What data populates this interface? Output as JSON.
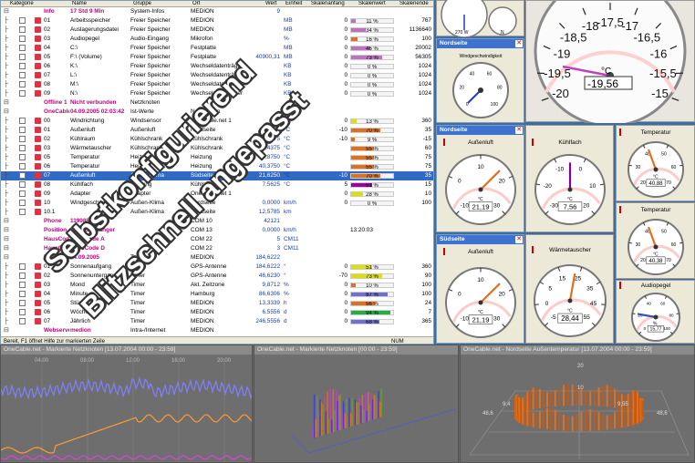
{
  "table": {
    "headers": {
      "category": "Kategorie",
      "name": "Name",
      "group": "Gruppe",
      "place": "Ort",
      "value": "Wert",
      "unit": "Einheit",
      "scale_start": "Skalenanfang",
      "scale_value": "Skalenwert",
      "scale_end": "Skalenende"
    },
    "rows": [
      {
        "kind": "group",
        "num": "Info",
        "name": "17 Std 9 Min",
        "group": "System-Infos",
        "place": "MEDION",
        "value": "9",
        "unit": "",
        "start": "",
        "bar_pct": null,
        "bar_color": "",
        "bar_text": "",
        "end": ""
      },
      {
        "kind": "item",
        "num": "01",
        "name": "Arbeitsspeicher",
        "group": "Freier Speicher",
        "place": "MEDION",
        "value": "",
        "unit": "MB",
        "start": "0",
        "bar_pct": 11,
        "bar_color": "#c070c0",
        "bar_text": "11 %",
        "end": "767"
      },
      {
        "kind": "item",
        "num": "02",
        "name": "Auslagerungsdatei",
        "group": "Freier Speicher",
        "place": "MEDION",
        "value": "",
        "unit": "MB",
        "start": "0",
        "bar_pct": 34,
        "bar_color": "#c070c0",
        "bar_text": "34 %",
        "end": "1136640"
      },
      {
        "kind": "item",
        "num": "03",
        "name": "Audiopegel",
        "group": "Audio-Eingang",
        "place": "Mikrofon",
        "value": "",
        "unit": "%",
        "start": "0",
        "bar_pct": 16,
        "bar_color": "#e07020",
        "bar_text": "16 %",
        "end": "100"
      },
      {
        "kind": "item",
        "num": "04",
        "name": "C:\\",
        "group": "Freier Speicher",
        "place": "Festplatte",
        "value": "",
        "unit": "MB",
        "start": "0",
        "bar_pct": 46,
        "bar_color": "#c070c0",
        "bar_text": "46 %",
        "end": "20002"
      },
      {
        "kind": "item",
        "num": "05",
        "name": "F:\\ (Volume)",
        "group": "Freier Speicher",
        "place": "Festplatte",
        "value": "40900,31",
        "unit": "MB",
        "start": "0",
        "bar_pct": 73,
        "bar_color": "#c070c0",
        "bar_text": "73 %",
        "end": "56305"
      },
      {
        "kind": "item",
        "num": "06",
        "name": "K:\\",
        "group": "Freier Speicher",
        "place": "Wechseldatenträger",
        "value": "",
        "unit": "KB",
        "start": "0",
        "bar_pct": 0,
        "bar_color": "#c070c0",
        "bar_text": "0 %",
        "end": "1024"
      },
      {
        "kind": "item",
        "num": "07",
        "name": "L:\\",
        "group": "Freier Speicher",
        "place": "Wechseldatenträger",
        "value": "",
        "unit": "KB",
        "start": "0",
        "bar_pct": 0,
        "bar_color": "#c070c0",
        "bar_text": "0 %",
        "end": "1024"
      },
      {
        "kind": "item",
        "num": "08",
        "name": "M:\\",
        "group": "Freier Speicher",
        "place": "Wechseldatenträger",
        "value": "",
        "unit": "KB",
        "start": "0",
        "bar_pct": 0,
        "bar_color": "#c070c0",
        "bar_text": "0 %",
        "end": "1024"
      },
      {
        "kind": "item",
        "num": "09",
        "name": "N:\\",
        "group": "Freier Speicher",
        "place": "Wechseldatenträger",
        "value": "",
        "unit": "KB",
        "start": "0",
        "bar_pct": 0,
        "bar_color": "#c070c0",
        "bar_text": "0 %",
        "end": "1024"
      },
      {
        "kind": "group",
        "num": "Offline 1",
        "name": "Nicht verbunden",
        "group": "Netzknoten",
        "place": "",
        "value": "",
        "unit": "",
        "start": "",
        "bar_pct": null,
        "bar_color": "",
        "bar_text": "",
        "end": ""
      },
      {
        "kind": "group",
        "num": "OneCable 1",
        "name": "04.09.2005 02:03:42",
        "group": "Ist-Werte",
        "place": "Netzknoten",
        "value": "",
        "unit": "",
        "start": "",
        "bar_pct": null,
        "bar_color": "",
        "bar_text": "",
        "end": ""
      },
      {
        "kind": "item",
        "num": "00",
        "name": "Windrichtung",
        "group": "Windsensor",
        "place": "OneCable.net 1",
        "value": "",
        "unit": "°",
        "start": "0",
        "bar_pct": 13,
        "bar_color": "#e0e000",
        "bar_text": "13 %",
        "end": "360"
      },
      {
        "kind": "item",
        "num": "01",
        "name": "Außenluft",
        "group": "Außenluft",
        "place": "Nordseite",
        "value": "",
        "unit": "°C",
        "start": "-10",
        "bar_pct": 70,
        "bar_color": "#e07020",
        "bar_text": "70 %",
        "end": "35"
      },
      {
        "kind": "item",
        "num": "02",
        "name": "Kühlraum",
        "group": "Kühlschrank",
        "place": "Kühlschrank",
        "value": "7,1875",
        "unit": "°C",
        "start": "-10",
        "bar_pct": 9,
        "bar_color": "#e07020",
        "bar_text": "9 %",
        "end": "-15"
      },
      {
        "kind": "item",
        "num": "03",
        "name": "Wärmetauscher",
        "group": "Kühlschrank",
        "place": "Kühlschrank",
        "value": "28,4375",
        "unit": "°C",
        "start": "",
        "bar_pct": 55,
        "bar_color": "#e07020",
        "bar_text": "55 %",
        "end": "60"
      },
      {
        "kind": "item",
        "num": "05",
        "name": "Temperatur",
        "group": "Heizung",
        "place": "Heizung",
        "value": "40,8750",
        "unit": "°C",
        "start": "",
        "bar_pct": 55,
        "bar_color": "#e07020",
        "bar_text": "55 %",
        "end": "75"
      },
      {
        "kind": "item",
        "num": "06",
        "name": "Temperatur",
        "group": "Heizung",
        "place": "Heizung",
        "value": "40,3750",
        "unit": "°C",
        "start": "",
        "bar_pct": 55,
        "bar_color": "#e07020",
        "bar_text": "55 %",
        "end": "75"
      },
      {
        "kind": "item",
        "num": "07",
        "name": "Außenluft",
        "group": "Außen-Klima",
        "place": "Südseite",
        "value": "21,6250",
        "unit": "°C",
        "start": "-10",
        "bar_pct": 70,
        "bar_color": "#e07020",
        "bar_text": "70 %",
        "end": "35",
        "selected": true
      },
      {
        "kind": "item",
        "num": "08",
        "name": "Kühlfach",
        "group": "Kühlung",
        "place": "Kühlschrank",
        "value": "7,5625",
        "unit": "°C",
        "start": "5",
        "bar_pct": 51,
        "bar_color": "#a000a0",
        "bar_text": "51 %",
        "end": "15"
      },
      {
        "kind": "item",
        "num": "09",
        "name": "Adapter",
        "group": "Adapter",
        "place": "OneCable.net 1",
        "value": "",
        "unit": "",
        "start": "0",
        "bar_pct": 28,
        "bar_color": "#e0e000",
        "bar_text": "28 %",
        "end": "10"
      },
      {
        "kind": "item",
        "num": "10",
        "name": "Windgeschwindigkeit",
        "group": "Außen-Klima",
        "place": "Nordseite",
        "value": "0,0000",
        "unit": "km/h",
        "start": "0",
        "bar_pct": 0,
        "bar_color": "#e0e000",
        "bar_text": "0 %",
        "end": "100"
      },
      {
        "kind": "item",
        "num": "10.1",
        "name": "",
        "group": "Außen-Klima",
        "place": "Nordseite",
        "value": "12,5785",
        "unit": "km",
        "start": "",
        "bar_pct": null,
        "bar_color": "",
        "bar_text": "",
        "end": ""
      },
      {
        "kind": "group",
        "num": "Phone",
        "name": "11998566",
        "group": "",
        "place": "COM 10",
        "value": "42121",
        "unit": "",
        "start": "",
        "bar_pct": null,
        "bar_color": "",
        "bar_text": "",
        "end": ""
      },
      {
        "kind": "group",
        "num": "Position",
        "name": "GPS-Empfänger",
        "group": "",
        "place": "COM 13",
        "value": "0,0000",
        "unit": "km/h",
        "start": "",
        "bar_pct": null,
        "bar_color": "",
        "bar_text": "13:20:03",
        "end": ""
      },
      {
        "kind": "group",
        "num": "HausCode A",
        "name": "HausCode A",
        "group": "",
        "place": "COM 22",
        "value": "5",
        "unit": "CM11",
        "start": "",
        "bar_pct": null,
        "bar_color": "",
        "bar_text": "",
        "end": ""
      },
      {
        "kind": "group",
        "num": "HausCode D",
        "name": "HausCode D",
        "group": "",
        "place": "COM 22",
        "value": "3",
        "unit": "CM11",
        "start": "",
        "bar_pct": null,
        "bar_color": "",
        "bar_text": "",
        "end": ""
      },
      {
        "kind": "group",
        "num": "Timer",
        "name": "04.09.2005",
        "group": "Termine",
        "place": "MEDION",
        "value": "184,6222",
        "unit": "",
        "start": "",
        "bar_pct": null,
        "bar_color": "",
        "bar_text": "",
        "end": ""
      },
      {
        "kind": "item",
        "num": "01",
        "name": "Sonnenaufgang",
        "group": "Timer",
        "place": "GPS-Antenne",
        "value": "184,6222",
        "unit": "°",
        "start": "0",
        "bar_pct": 51,
        "bar_color": "#e0e000",
        "bar_text": "51 %",
        "end": "360"
      },
      {
        "kind": "item",
        "num": "02",
        "name": "Sonnenuntergang",
        "group": "Timer",
        "place": "GPS-Antenne",
        "value": "46,6230",
        "unit": "°",
        "start": "-70",
        "bar_pct": 73,
        "bar_color": "#e0e000",
        "bar_text": "73 %",
        "end": "90"
      },
      {
        "kind": "item",
        "num": "03",
        "name": "Mond",
        "group": "Timer",
        "place": "Akt. Zeitzone",
        "value": "9,8712",
        "unit": "%",
        "start": "0",
        "bar_pct": 10,
        "bar_color": "#e07020",
        "bar_text": "10 %",
        "end": "100"
      },
      {
        "kind": "item",
        "num": "04",
        "name": "Minute",
        "group": "Timer",
        "place": "Hamburg",
        "value": "86,6306",
        "unit": "%",
        "start": "0",
        "bar_pct": 87,
        "bar_color": "#7070d0",
        "bar_text": "87 %",
        "end": "100"
      },
      {
        "kind": "item",
        "num": "05",
        "name": "Stündlich",
        "group": "Timer",
        "place": "MEDION",
        "value": "13,3339",
        "unit": "h",
        "start": "0",
        "bar_pct": 56,
        "bar_color": "#e07020",
        "bar_text": "56 %",
        "end": "24"
      },
      {
        "kind": "item",
        "num": "06",
        "name": "Wöchentlich",
        "group": "Timer",
        "place": "MEDION",
        "value": "6,5556",
        "unit": "d",
        "start": "0",
        "bar_pct": 94,
        "bar_color": "#20b040",
        "bar_text": "94 %",
        "end": "7"
      },
      {
        "kind": "item",
        "num": "07",
        "name": "Jährlich",
        "group": "Timer",
        "place": "MEDION",
        "value": "246,5556",
        "unit": "d",
        "start": "0",
        "bar_pct": 68,
        "bar_color": "#7070d0",
        "bar_text": "68 %",
        "end": "365"
      },
      {
        "kind": "group",
        "num": "Webserver",
        "name": "medion",
        "group": "Intra-/Internet",
        "place": "MEDION",
        "value": "",
        "unit": "",
        "start": "",
        "bar_pct": null,
        "bar_color": "",
        "bar_text": "",
        "end": ""
      }
    ]
  },
  "statusbar": {
    "text": "Bereit, F1 öffnet Hilfe zur markierten Zeile",
    "mode": "NUM"
  },
  "windows": {
    "nordseite1": {
      "title": "Nordseite"
    },
    "nordseite2": {
      "title": "Nordseite"
    },
    "suedseite": {
      "title": "Südseite"
    }
  },
  "gauges": {
    "big": {
      "unit": "°C",
      "value": "-19,56",
      "ticks": [
        "-20",
        "-19,5",
        "-19",
        "-18,5",
        "-18",
        "-17,5",
        "-17",
        "-16,5",
        "-16",
        "-15,5",
        "-15"
      ]
    },
    "compass": {
      "labels": [
        "270 W",
        "N"
      ]
    },
    "wind": {
      "title": "Windgeschwindigkeit",
      "ticks": [
        "0",
        "20",
        "40",
        "60",
        "80",
        "100"
      ]
    },
    "nord_aussen": {
      "title": "Außenluft",
      "unit": "°C",
      "value": "21,19",
      "ticks": [
        "-10",
        "0",
        "10",
        "20",
        "30"
      ]
    },
    "kuehlfach": {
      "title": "Kühlfach",
      "unit": "°C",
      "value": "7,56",
      "ticks": [
        "-30",
        "-20",
        "-10",
        "0",
        "10",
        "20"
      ]
    },
    "temp1": {
      "title": "Temperatur",
      "unit": "°C",
      "value": "40,88",
      "ticks": [
        "20",
        "30",
        "40",
        "50",
        "60",
        "70"
      ]
    },
    "temp2": {
      "title": "Temperatur",
      "unit": "°C",
      "value": "40,38",
      "ticks": [
        "20",
        "30",
        "40",
        "50",
        "60",
        "70"
      ]
    },
    "sued_aussen": {
      "title": "Außenluft",
      "unit": "°C",
      "value": "21,19",
      "ticks": [
        "-10",
        "0",
        "10",
        "20",
        "30"
      ]
    },
    "waerme": {
      "title": "Wärmetauscher",
      "unit": "°C",
      "value": "28,44",
      "ticks": [
        "-5",
        "0",
        "5",
        "15",
        "25",
        "35",
        "45",
        "55"
      ]
    },
    "audio": {
      "title": "Audiopegel",
      "unit": "%",
      "value": "15,77",
      "ticks": [
        "0",
        "20",
        "40",
        "60",
        "80",
        "100"
      ]
    }
  },
  "charts": {
    "left": {
      "title": "OneCable.net - Markierte Netzknoten [13.07.2004 00:00 - 23:59]",
      "ticks": [
        "04:00",
        "08:00",
        "12:00",
        "16:00",
        "20:00"
      ]
    },
    "middle": {
      "title": "OneCable.net - Markierte Netzknoten [00:00 - 23:59]"
    },
    "right": {
      "title": "OneCable.net - Nordseite Außentemperatur [13.07.2004 00:00 - 23:59]",
      "labels": [
        "9,4",
        "20",
        "10",
        "9,55",
        "48,6",
        "48,6"
      ]
    }
  },
  "watermark": {
    "line1": "Selbstkonfigurierend",
    "line2": "Blitzschnell angepasst"
  },
  "colors": {
    "accent": "#316ac5",
    "title_blue": "#3f72d0",
    "group_magenta": "#c00080"
  }
}
